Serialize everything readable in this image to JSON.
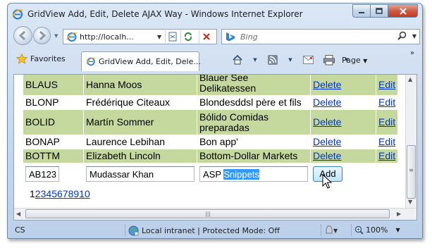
{
  "window": {
    "title": "GridView Add, Edit, Delete AJAX Way - Windows Internet Explorer"
  },
  "address_bar": {
    "url": "http://localh...",
    "search_engine": "Bing"
  },
  "command_bar": {
    "favorites_label": "Favorites",
    "tab_title": "GridView Add, Edit, Dele...",
    "page_menu_label": "Page",
    "more_chevron": "»"
  },
  "grid": {
    "delete_label": "Delete",
    "edit_label": "Edit",
    "rows": [
      {
        "id": "BLAUS",
        "name": "Hanna Moos",
        "company_l1": "Blauer See",
        "company_l2": "Delikatessen"
      },
      {
        "id": "BLONP",
        "name": "Frédérique Citeaux",
        "company_l1": "Blondesddsl père et fils",
        "company_l2": ""
      },
      {
        "id": "BOLID",
        "name": "Martín Sommer",
        "company_l1": "Bólido Comidas",
        "company_l2": "preparadas"
      },
      {
        "id": "BONAP",
        "name": "Laurence Lebihan",
        "company_l1": "Bon app'",
        "company_l2": ""
      },
      {
        "id": "BOTTM",
        "name": "Elizabeth Lincoln",
        "company_l1": "Bottom-Dollar Markets",
        "company_l2": ""
      }
    ],
    "footer": {
      "id_value": "AB123",
      "name_value": "Mudassar Khan",
      "company_value_plain": "ASP ",
      "company_value_selected": "Snippets",
      "add_label": "Add"
    },
    "pager": {
      "current": "1",
      "pages": [
        "2",
        "3",
        "4",
        "5",
        "6",
        "7",
        "8",
        "9",
        "10"
      ]
    }
  },
  "status_bar": {
    "left_text": "CS",
    "zone_text": "Local intranet | Protected Mode: Off",
    "zoom_text": "100%"
  },
  "colors": {
    "row_alt": "#c5d89e",
    "link": "#0033cc",
    "selection": "#3399ff"
  }
}
